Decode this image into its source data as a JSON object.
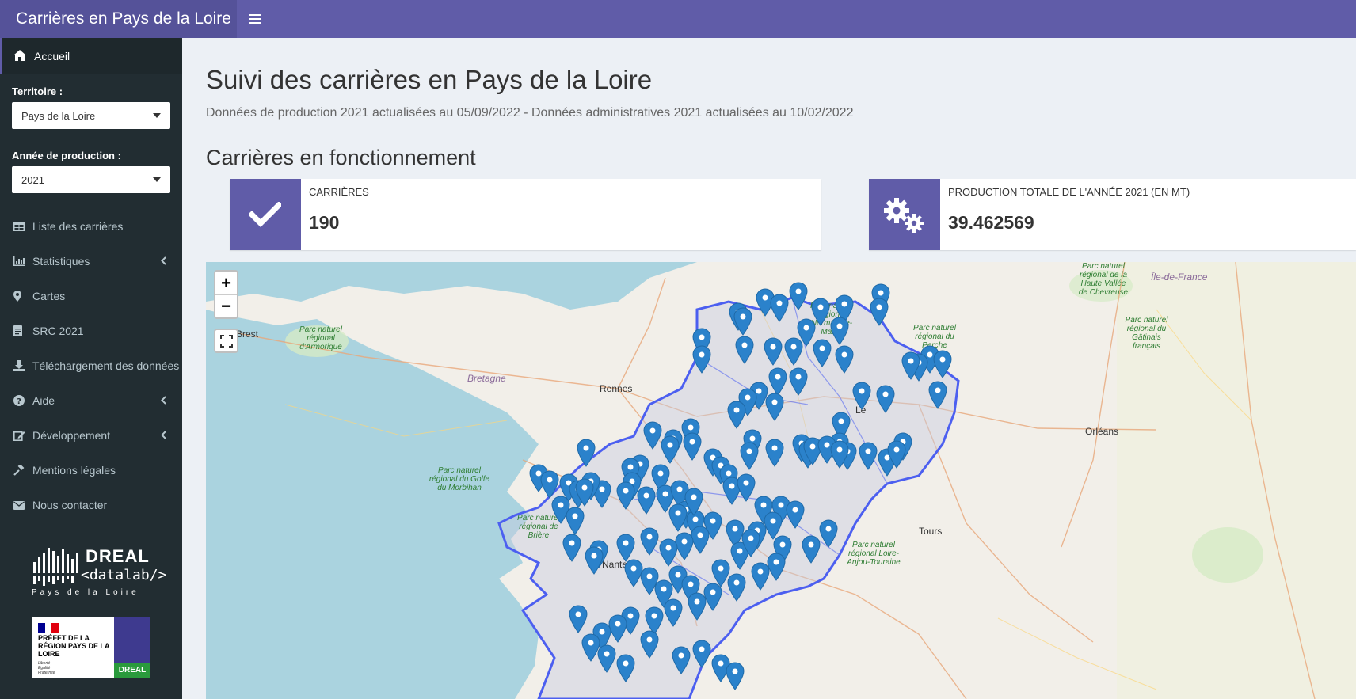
{
  "header": {
    "brand": "Carrières en Pays de la Loire",
    "toggle_icon": "hamburger-icon"
  },
  "colors": {
    "header": "#605ca8",
    "brand_bg": "#555299",
    "sidebar": "#222d32",
    "info_icon_bg": "#605ca8",
    "marker": "#2b82cb",
    "region_border": "#4c5ff0"
  },
  "sidebar": {
    "home": {
      "label": "Accueil",
      "icon": "home-icon"
    },
    "territoire": {
      "label": "Territoire :",
      "value": "Pays de la Loire"
    },
    "annee": {
      "label": "Année de production :",
      "value": "2021"
    },
    "items": [
      {
        "label": "Liste des carrières",
        "icon": "table-icon",
        "chevron": false
      },
      {
        "label": "Statistiques",
        "icon": "chart-icon",
        "chevron": true
      },
      {
        "label": "Cartes",
        "icon": "map-marker-icon",
        "chevron": false
      },
      {
        "label": "SRC 2021",
        "icon": "document-icon",
        "chevron": false
      },
      {
        "label": "Téléchargement des données",
        "icon": "download-icon",
        "chevron": false
      },
      {
        "label": "Aide",
        "icon": "question-icon",
        "chevron": true
      },
      {
        "label": "Développement",
        "icon": "edit-icon",
        "chevron": true
      },
      {
        "label": "Mentions légales",
        "icon": "gavel-icon",
        "chevron": false
      },
      {
        "label": "Nous contacter",
        "icon": "envelope-icon",
        "chevron": false
      }
    ],
    "dreal_logo": {
      "title": "DREAL",
      "sub": "<datalab/>",
      "region": "Pays de la Loire"
    },
    "prefet_logo": {
      "text": "PRÉFET DE LA RÉGION PAYS DE LA LOIRE",
      "motto": "Liberté Égalité Fraternité",
      "dreal": "DREAL"
    }
  },
  "main": {
    "title": "Suivi des carrières en Pays de la Loire",
    "subtitle": "Données de production 2021 actualisées au 05/09/2022 - Données administratives 2021 actualisées au 10/02/2022",
    "section_title": "Carrières en fonctionnement",
    "info_boxes": [
      {
        "label": "Carrières",
        "value": "190",
        "icon": "check-icon"
      },
      {
        "label": "Production totale de l'année 2021 (en Mt)",
        "value": "39.462569",
        "icon": "gears-icon"
      }
    ]
  },
  "map": {
    "zoom_in": "+",
    "zoom_out": "−",
    "labels": {
      "rennes": "Rennes",
      "brest": "Brest",
      "bretagne": "Bretagne",
      "orleans": "Orléans",
      "tours": "Tours",
      "ile_de_france": "Île-de-France",
      "nantes": "Nante",
      "le_mans": "Le",
      "la": "la",
      "park_armorique": "Parc naturel régional d'Armorique",
      "park_morbihan": "Parc naturel régional du Golfe du Morbihan",
      "park_briere": "Parc naturel régional de Brière",
      "park_normandie": "Parc naturel régional Normandie-Maine",
      "park_perche": "Parc naturel régional du Perche",
      "park_chevreuse": "Parc naturel régional de la Haute Vallée de Chevreuse",
      "park_gatinais": "Parc naturel régional du Gâtinais français",
      "park_loire_anjou": "Parc naturel régional Loire-Anjou-Touraine"
    }
  }
}
